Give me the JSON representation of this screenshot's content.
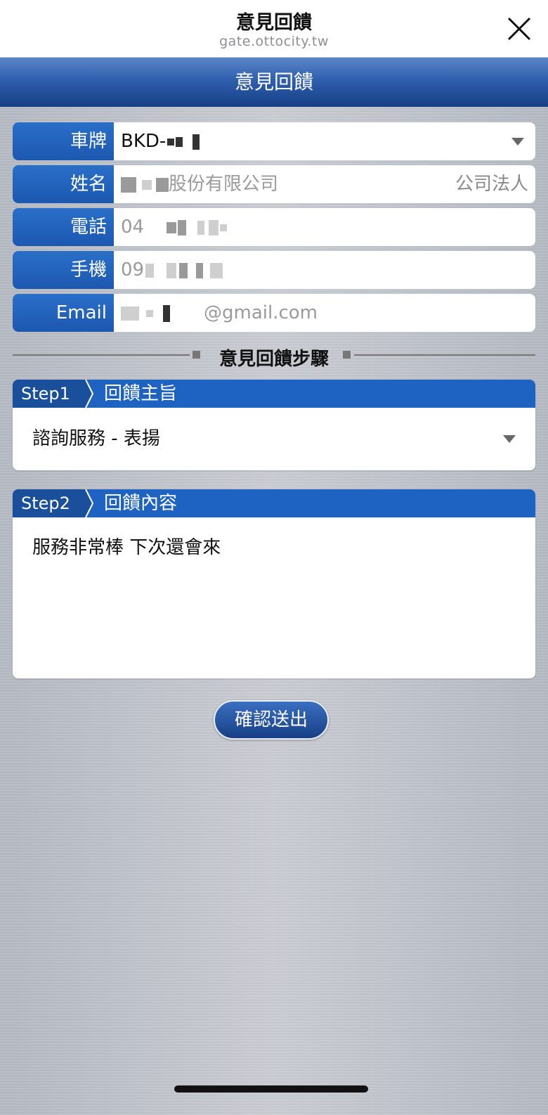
{
  "browser": {
    "title": "意見回饋",
    "url": "gate.ottocity.tw"
  },
  "banner": {
    "title": "意見回饋"
  },
  "form": {
    "plate": {
      "label": "車牌",
      "value": "BKD-"
    },
    "name": {
      "label": "姓名",
      "value": "股份有限公司",
      "tag": "公司法人"
    },
    "phone": {
      "label": "電話",
      "value": "04"
    },
    "mobile": {
      "label": "手機",
      "value": "09"
    },
    "email": {
      "label": "Email",
      "value": "@gmail.com"
    }
  },
  "section_title": "意見回饋步驟",
  "step1": {
    "step": "Step1",
    "title": "回饋主旨",
    "selected": "諮詢服務 - 表揚"
  },
  "step2": {
    "step": "Step2",
    "title": "回饋內容",
    "content": "服務非常棒 下次還會來"
  },
  "submit_label": "確認送出"
}
